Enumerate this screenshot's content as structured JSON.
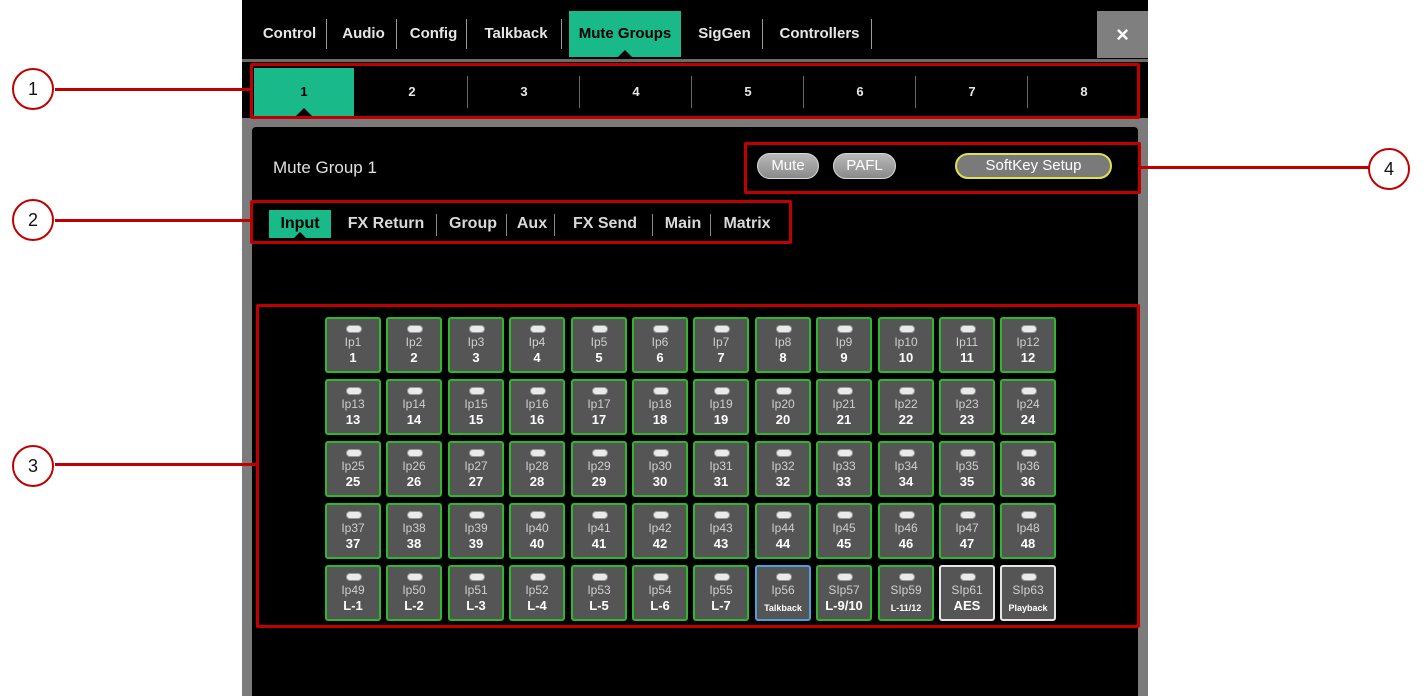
{
  "top_tabs": [
    {
      "label": "Control",
      "active": false
    },
    {
      "label": "Audio",
      "active": false
    },
    {
      "label": "Config",
      "active": false
    },
    {
      "label": "Talkback",
      "active": false
    },
    {
      "label": "Mute Groups",
      "active": true
    },
    {
      "label": "SigGen",
      "active": false
    },
    {
      "label": "Controllers",
      "active": false
    }
  ],
  "close_label": "×",
  "group_tabs": [
    "1",
    "2",
    "3",
    "4",
    "5",
    "6",
    "7",
    "8"
  ],
  "active_group": "1",
  "panel": {
    "title": "Mute Group 1",
    "mute_label": "Mute",
    "pafl_label": "PAFL",
    "softkey_label": "SoftKey Setup"
  },
  "sub_tabs": [
    {
      "label": "Input",
      "active": true
    },
    {
      "label": "FX Return",
      "active": false
    },
    {
      "label": "Group",
      "active": false
    },
    {
      "label": "Aux",
      "active": false
    },
    {
      "label": "FX Send",
      "active": false
    },
    {
      "label": "Main",
      "active": false
    },
    {
      "label": "Matrix",
      "active": false
    }
  ],
  "channels": [
    {
      "src": "Ip1",
      "label": "1"
    },
    {
      "src": "Ip2",
      "label": "2"
    },
    {
      "src": "Ip3",
      "label": "3"
    },
    {
      "src": "Ip4",
      "label": "4"
    },
    {
      "src": "Ip5",
      "label": "5"
    },
    {
      "src": "Ip6",
      "label": "6"
    },
    {
      "src": "Ip7",
      "label": "7"
    },
    {
      "src": "Ip8",
      "label": "8"
    },
    {
      "src": "Ip9",
      "label": "9"
    },
    {
      "src": "Ip10",
      "label": "10"
    },
    {
      "src": "Ip11",
      "label": "11"
    },
    {
      "src": "Ip12",
      "label": "12"
    },
    {
      "src": "Ip13",
      "label": "13"
    },
    {
      "src": "Ip14",
      "label": "14"
    },
    {
      "src": "Ip15",
      "label": "15"
    },
    {
      "src": "Ip16",
      "label": "16"
    },
    {
      "src": "Ip17",
      "label": "17"
    },
    {
      "src": "Ip18",
      "label": "18"
    },
    {
      "src": "Ip19",
      "label": "19"
    },
    {
      "src": "Ip20",
      "label": "20"
    },
    {
      "src": "Ip21",
      "label": "21"
    },
    {
      "src": "Ip22",
      "label": "22"
    },
    {
      "src": "Ip23",
      "label": "23"
    },
    {
      "src": "Ip24",
      "label": "24"
    },
    {
      "src": "Ip25",
      "label": "25"
    },
    {
      "src": "Ip26",
      "label": "26"
    },
    {
      "src": "Ip27",
      "label": "27"
    },
    {
      "src": "Ip28",
      "label": "28"
    },
    {
      "src": "Ip29",
      "label": "29"
    },
    {
      "src": "Ip30",
      "label": "30"
    },
    {
      "src": "Ip31",
      "label": "31"
    },
    {
      "src": "Ip32",
      "label": "32"
    },
    {
      "src": "Ip33",
      "label": "33"
    },
    {
      "src": "Ip34",
      "label": "34"
    },
    {
      "src": "Ip35",
      "label": "35"
    },
    {
      "src": "Ip36",
      "label": "36"
    },
    {
      "src": "Ip37",
      "label": "37"
    },
    {
      "src": "Ip38",
      "label": "38"
    },
    {
      "src": "Ip39",
      "label": "39"
    },
    {
      "src": "Ip40",
      "label": "40"
    },
    {
      "src": "Ip41",
      "label": "41"
    },
    {
      "src": "Ip42",
      "label": "42"
    },
    {
      "src": "Ip43",
      "label": "43"
    },
    {
      "src": "Ip44",
      "label": "44"
    },
    {
      "src": "Ip45",
      "label": "45"
    },
    {
      "src": "Ip46",
      "label": "46"
    },
    {
      "src": "Ip47",
      "label": "47"
    },
    {
      "src": "Ip48",
      "label": "48"
    },
    {
      "src": "Ip49",
      "label": "L-1"
    },
    {
      "src": "Ip50",
      "label": "L-2"
    },
    {
      "src": "Ip51",
      "label": "L-3"
    },
    {
      "src": "Ip52",
      "label": "L-4"
    },
    {
      "src": "Ip53",
      "label": "L-5"
    },
    {
      "src": "Ip54",
      "label": "L-6"
    },
    {
      "src": "Ip55",
      "label": "L-7"
    },
    {
      "src": "Ip56",
      "label": "Talkback",
      "color": "blue"
    },
    {
      "src": "SIp57",
      "label": "L-9/10"
    },
    {
      "src": "SIp59",
      "label": "L-11/12"
    },
    {
      "src": "SIp61",
      "label": "AES",
      "color": "white"
    },
    {
      "src": "SIp63",
      "label": "Playback",
      "color": "white"
    }
  ],
  "annotations": [
    "1",
    "2",
    "3",
    "4"
  ],
  "colors": {
    "active_tab": "#19b98a",
    "channel_border": "#2eb82e",
    "talkback_border": "#4aa0d8",
    "annotation": "#c00000"
  }
}
